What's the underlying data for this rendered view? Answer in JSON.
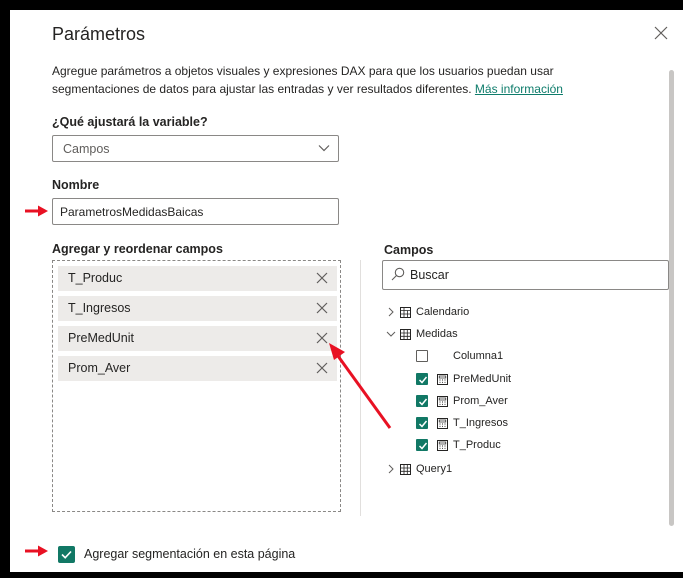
{
  "dialog": {
    "title": "Parámetros",
    "description": "Agregue parámetros a objetos visuales y expresiones DAX para que los usuarios puedan usar segmentaciones de datos para ajustar las entradas y ver resultados diferentes.",
    "more_info": "Más información"
  },
  "variable": {
    "label": "¿Qué ajustará la variable?",
    "selected": "Campos"
  },
  "name": {
    "label": "Nombre",
    "value": "ParametrosMedidasBaicas"
  },
  "add_fields": {
    "label": "Agregar y reordenar campos",
    "items": [
      "T_Produc",
      "T_Ingresos",
      "PreMedUnit",
      "Prom_Aver"
    ]
  },
  "fields_panel": {
    "label": "Campos",
    "search_placeholder": "Buscar",
    "tables": [
      {
        "name": "Calendario",
        "expanded": false
      },
      {
        "name": "Medidas",
        "expanded": true
      },
      {
        "name": "Query1",
        "expanded": false
      }
    ],
    "measures": [
      {
        "name": "Columna1",
        "checked": false,
        "is_measure": false
      },
      {
        "name": "PreMedUnit",
        "checked": true,
        "is_measure": true
      },
      {
        "name": "Prom_Aver",
        "checked": true,
        "is_measure": true
      },
      {
        "name": "T_Ingresos",
        "checked": true,
        "is_measure": true
      },
      {
        "name": "T_Produc",
        "checked": true,
        "is_measure": true
      }
    ]
  },
  "footer": {
    "add_slicer_label": "Agregar segmentación en esta página",
    "add_slicer_checked": true
  },
  "colors": {
    "accent": "#117865",
    "link": "#0e7c6b",
    "annotation_arrow": "#e81123"
  }
}
